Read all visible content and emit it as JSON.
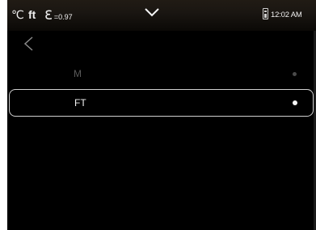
{
  "status_bar": {
    "temperature_unit": "℃",
    "distance_unit": "ft",
    "emissivity_symbol": "ℇ",
    "emissivity_value": "=0.97",
    "dropdown_icon": "chevron-down-icon",
    "battery_icon": "battery-icon",
    "time": "12:02 AM"
  },
  "navigation": {
    "back_icon": "chevron-left-icon"
  },
  "options": [
    {
      "label": "M",
      "selected": false
    },
    {
      "label": "FT",
      "selected": true
    }
  ],
  "colors": {
    "background": "#000000",
    "selected_border": "#d0d0d0",
    "selected_text": "#f2f2f2",
    "unselected_text": "#5a5a5a"
  }
}
